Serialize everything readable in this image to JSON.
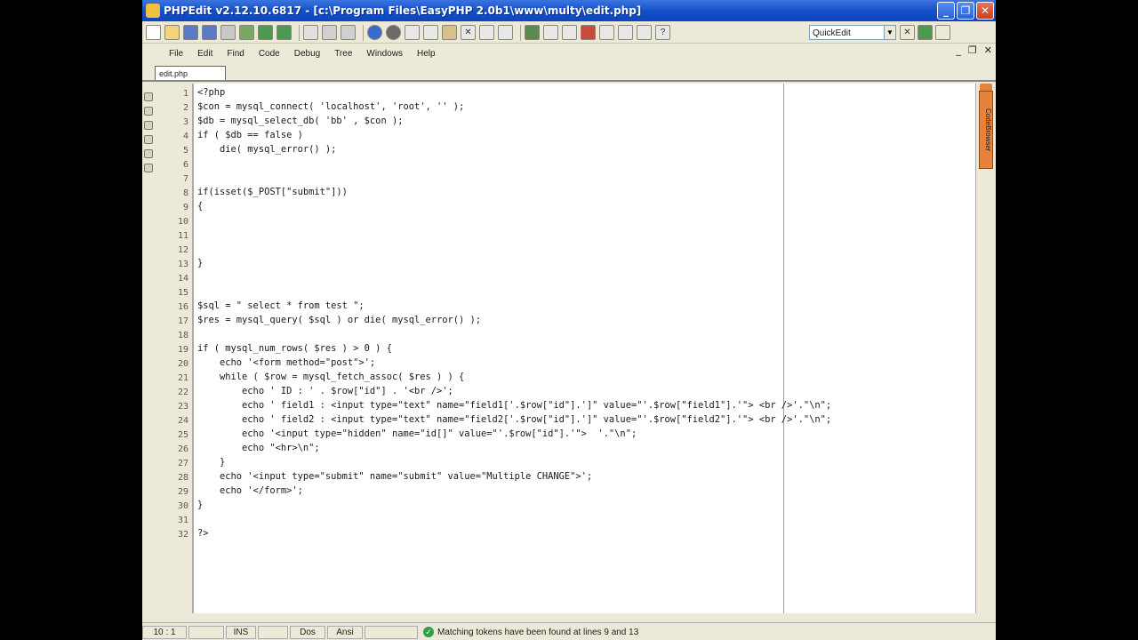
{
  "window": {
    "title": "PHPEdit v2.12.10.6817 - [c:\\Program Files\\EasyPHP 2.0b1\\www\\multy\\edit.php]",
    "btn_minimize": "_",
    "btn_restore": "❐",
    "btn_close": "✕"
  },
  "toolbar": {
    "quickedit_value": "QuickEdit"
  },
  "menu": {
    "items": [
      "File",
      "Edit",
      "Find",
      "Code",
      "Debug",
      "Tree",
      "Windows",
      "Help"
    ]
  },
  "mdi": {
    "minimize": "_",
    "restore": "❐",
    "close": "✕"
  },
  "tab": {
    "label": "edit.php"
  },
  "right_panel": {
    "label": "CodeBrowser"
  },
  "editor": {
    "lines": [
      "<?php",
      "$con = mysql_connect( 'localhost', 'root', '' );",
      "$db = mysql_select_db( 'bb' , $con );",
      "if ( $db == false )",
      "    die( mysql_error() );",
      "",
      "",
      "if(isset($_POST[\"submit\"]))",
      "{",
      "",
      "",
      "",
      "}",
      "",
      "",
      "$sql = \" select * from test \";",
      "$res = mysql_query( $sql ) or die( mysql_error() );",
      "",
      "if ( mysql_num_rows( $res ) > 0 ) {",
      "    echo '<form method=\"post\">';",
      "    while ( $row = mysql_fetch_assoc( $res ) ) {",
      "        echo ' ID : ' . $row[\"id\"] . '<br />';",
      "        echo ' field1 : <input type=\"text\" name=\"field1['.$row[\"id\"].']\" value=\"'.$row[\"field1\"].'\"> <br />'.\"\\n\";",
      "        echo ' field2 : <input type=\"text\" name=\"field2['.$row[\"id\"].']\" value=\"'.$row[\"field2\"].'\"> <br />'.\"\\n\";",
      "        echo '<input type=\"hidden\" name=\"id[]\" value=\"'.$row[\"id\"].'\">  '.\"\\n\";",
      "        echo \"<hr>\\n\";",
      "    }",
      "    echo '<input type=\"submit\" name=\"submit\" value=\"Multiple CHANGE\">';",
      "    echo '</form>';",
      "}",
      "",
      "?>"
    ],
    "line_numbers": [
      "1",
      "2",
      "3",
      "4",
      "5",
      "6",
      "7",
      "8",
      "9",
      "10",
      "11",
      "12",
      "13",
      "14",
      "15",
      "16",
      "17",
      "18",
      "19",
      "20",
      "21",
      "22",
      "23",
      "24",
      "25",
      "26",
      "27",
      "28",
      "29",
      "30",
      "31",
      "32"
    ]
  },
  "status": {
    "position": "10 : 1",
    "insert_mode": "INS",
    "line_ending": "Dos",
    "encoding": "Ansi",
    "message": "Matching tokens have been found at lines 9 and 13"
  }
}
